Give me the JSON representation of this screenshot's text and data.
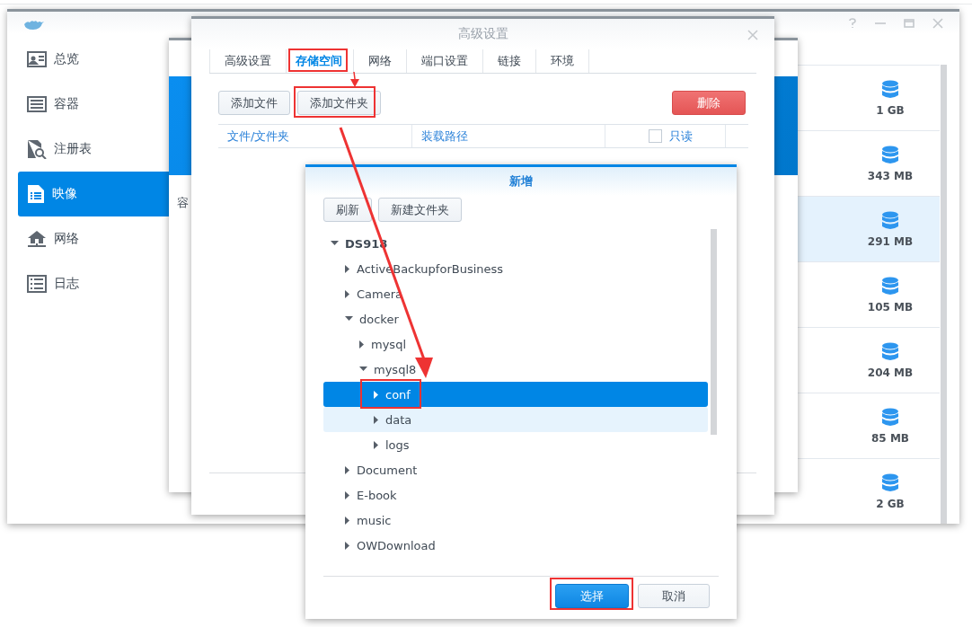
{
  "main_window": {
    "sidebar": [
      {
        "label": "总览",
        "selected": false
      },
      {
        "label": "容器",
        "selected": false
      },
      {
        "label": "注册表",
        "selected": false
      },
      {
        "label": "映像",
        "selected": true
      },
      {
        "label": "网络",
        "selected": false
      },
      {
        "label": "日志",
        "selected": false
      }
    ],
    "image_sizes": [
      {
        "size": "1 GB",
        "selected": false
      },
      {
        "size": "343 MB",
        "selected": false
      },
      {
        "size": "291 MB",
        "selected": true
      },
      {
        "size": "105 MB",
        "selected": false
      },
      {
        "size": "204 MB",
        "selected": false
      },
      {
        "size": "85 MB",
        "selected": false
      },
      {
        "size": "2 GB",
        "selected": false
      }
    ]
  },
  "back_dialog": {
    "label": "容"
  },
  "settings_dialog": {
    "title": "高级设置",
    "tabs": [
      {
        "label": "高级设置",
        "selected": false
      },
      {
        "label": "存储空间",
        "selected": true
      },
      {
        "label": "网络",
        "selected": false
      },
      {
        "label": "端口设置",
        "selected": false
      },
      {
        "label": "链接",
        "selected": false
      },
      {
        "label": "环境",
        "selected": false
      }
    ],
    "add_file": "添加文件",
    "add_folder": "添加文件夹",
    "delete": "删除",
    "columns": [
      "文件/文件夹",
      "装载路径"
    ],
    "readonly": {
      "label": "只读",
      "checked": false
    }
  },
  "folder_dialog": {
    "title": "新增",
    "refresh": "刷新",
    "new_folder": "新建文件夹",
    "tree": [
      {
        "label": "DS918",
        "expanded": true,
        "selected": false,
        "hovered": false,
        "children": [
          {
            "label": "ActiveBackupforBusiness",
            "expanded": false,
            "selected": false,
            "hovered": false
          },
          {
            "label": "Camera",
            "expanded": false,
            "selected": false,
            "hovered": false
          },
          {
            "label": "docker",
            "expanded": true,
            "selected": false,
            "hovered": false,
            "children": [
              {
                "label": "mysql",
                "expanded": false,
                "selected": false,
                "hovered": false
              },
              {
                "label": "mysql8",
                "expanded": true,
                "selected": false,
                "hovered": false,
                "children": [
                  {
                    "label": "conf",
                    "expanded": false,
                    "selected": true,
                    "hovered": false
                  },
                  {
                    "label": "data",
                    "expanded": false,
                    "selected": false,
                    "hovered": true
                  },
                  {
                    "label": "logs",
                    "expanded": false,
                    "selected": false,
                    "hovered": false
                  }
                ]
              }
            ]
          },
          {
            "label": "Document",
            "expanded": false,
            "selected": false,
            "hovered": false
          },
          {
            "label": "E-book",
            "expanded": false,
            "selected": false,
            "hovered": false
          },
          {
            "label": "music",
            "expanded": false,
            "selected": false,
            "hovered": false
          },
          {
            "label": "OWDownload",
            "expanded": false,
            "selected": false,
            "hovered": false
          }
        ]
      }
    ],
    "select": "选择",
    "cancel": "取消"
  }
}
